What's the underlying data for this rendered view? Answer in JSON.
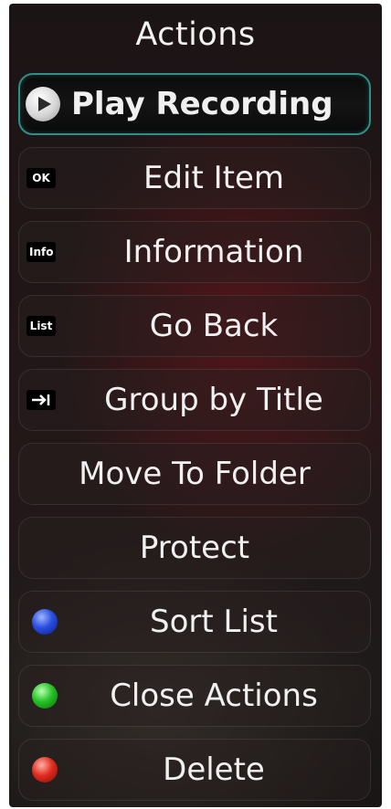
{
  "menu": {
    "title": "Actions",
    "items": [
      {
        "label": "Play Recording",
        "icon": "play-icon",
        "selected": true
      },
      {
        "label": "Edit Item",
        "icon": "ok-key-icon",
        "key_text": "OK"
      },
      {
        "label": "Information",
        "icon": "info-key-icon",
        "key_text": "Info"
      },
      {
        "label": "Go Back",
        "icon": "list-key-icon",
        "key_text": "List"
      },
      {
        "label": "Group by Title",
        "icon": "tab-arrow-icon"
      },
      {
        "label": "Move To Folder",
        "icon": null
      },
      {
        "label": "Protect",
        "icon": null
      },
      {
        "label": "Sort List",
        "icon": "blue-button-icon",
        "color": "#2a4fe0"
      },
      {
        "label": "Close Actions",
        "icon": "green-button-icon",
        "color": "#27c227"
      },
      {
        "label": "Delete",
        "icon": "red-button-icon",
        "color": "#e12d1f"
      }
    ]
  },
  "colors": {
    "selection_border": "#2f8f88",
    "text": "#f0f0f0"
  }
}
